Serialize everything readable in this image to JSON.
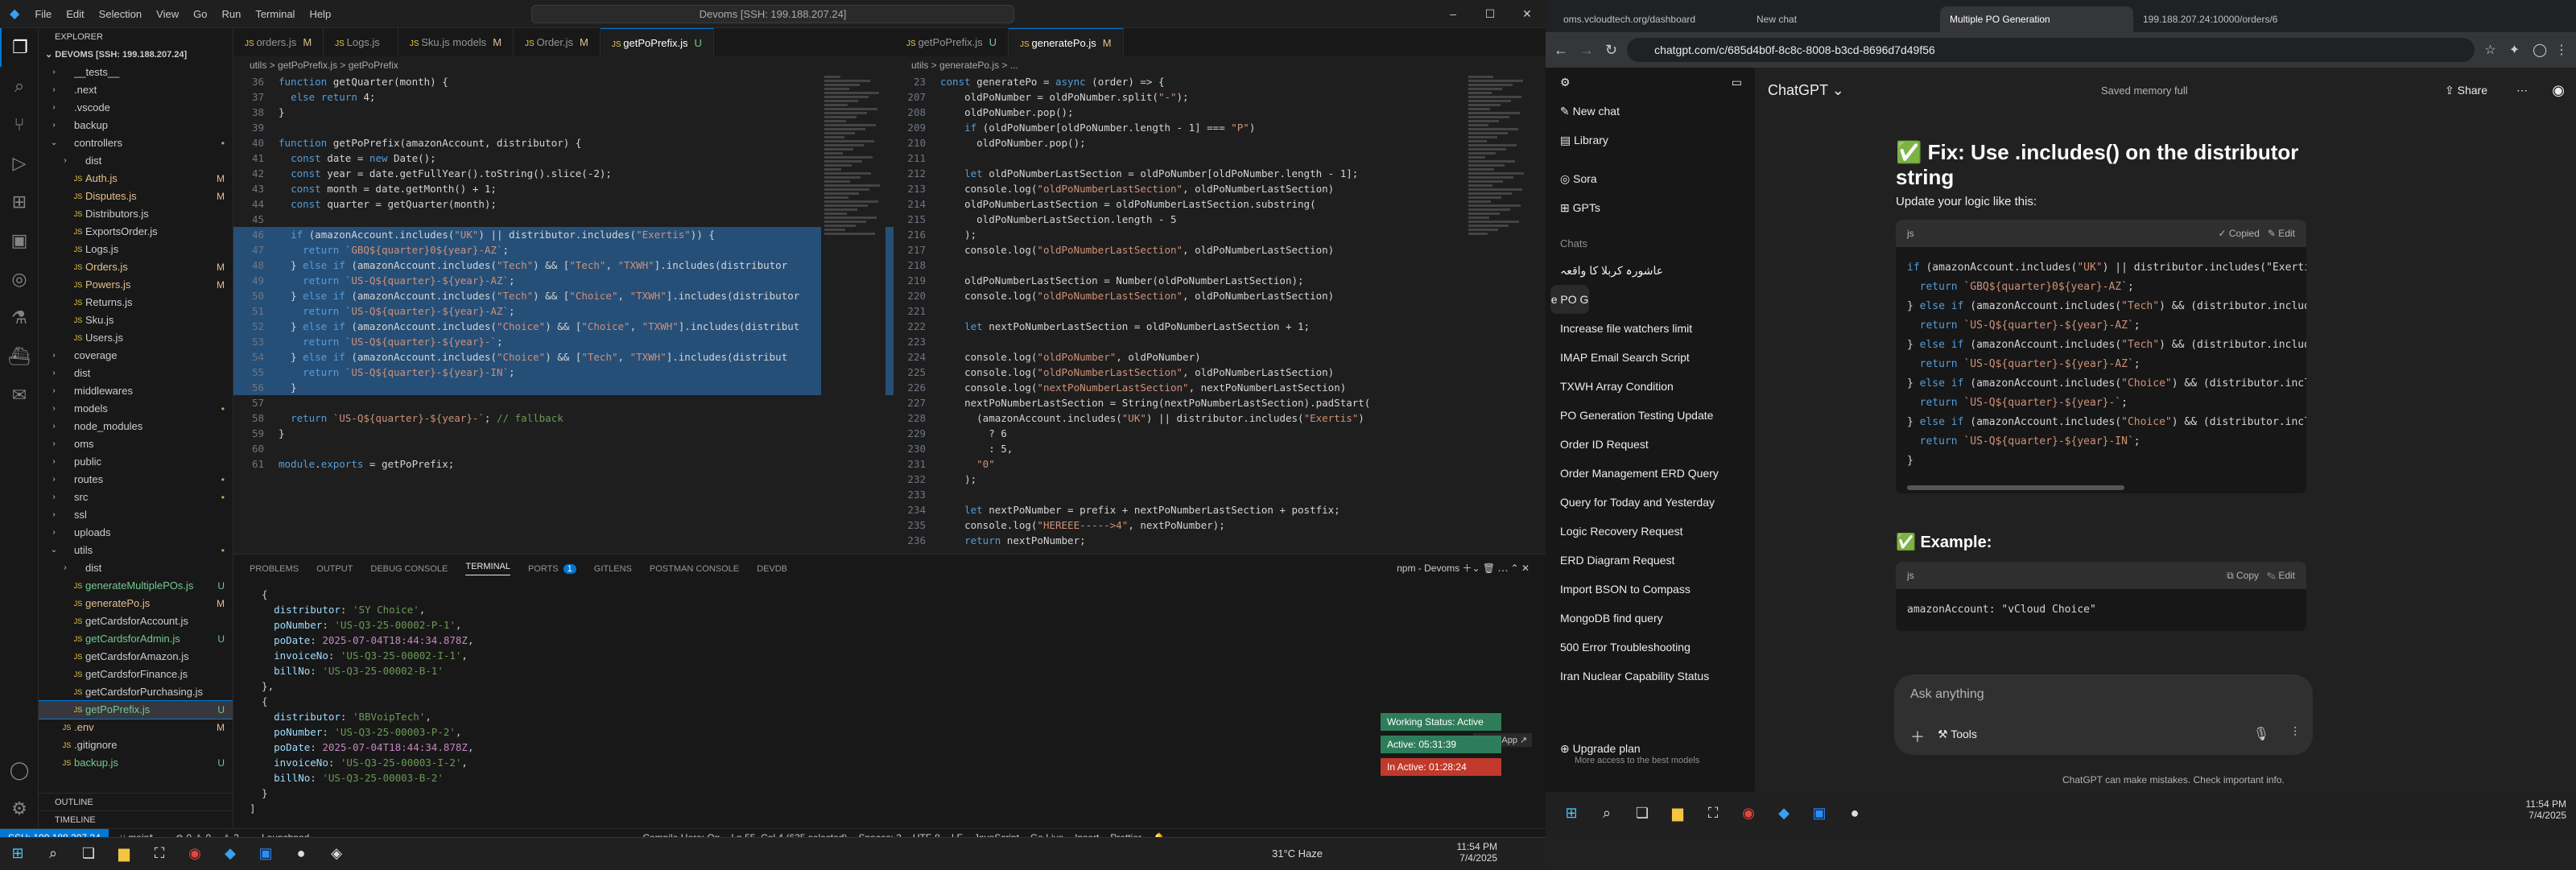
{
  "vscode": {
    "menu": [
      "File",
      "Edit",
      "Selection",
      "View",
      "Go",
      "Run",
      "Terminal",
      "Help"
    ],
    "command_center": "Devoms [SSH: 199.188.207.24]",
    "explorer_title": "EXPLORER",
    "workspace": "DEVOMS [SSH: 199.188.207.24]",
    "tree": [
      {
        "d": 0,
        "t": "f",
        "n": "__tests__",
        "s": ""
      },
      {
        "d": 0,
        "t": "f",
        "n": ".next",
        "s": ""
      },
      {
        "d": 0,
        "t": "f",
        "n": ".vscode",
        "s": ""
      },
      {
        "d": 0,
        "t": "f",
        "n": "backup",
        "s": ""
      },
      {
        "d": 0,
        "t": "fo",
        "n": "controllers",
        "s": "•"
      },
      {
        "d": 1,
        "t": "f",
        "n": "dist",
        "s": ""
      },
      {
        "d": 1,
        "t": "js",
        "n": "Auth.js",
        "s": "M"
      },
      {
        "d": 1,
        "t": "js",
        "n": "Disputes.js",
        "s": "M"
      },
      {
        "d": 1,
        "t": "js",
        "n": "Distributors.js",
        "s": ""
      },
      {
        "d": 1,
        "t": "js",
        "n": "ExportsOrder.js",
        "s": ""
      },
      {
        "d": 1,
        "t": "js",
        "n": "Logs.js",
        "s": ""
      },
      {
        "d": 1,
        "t": "js",
        "n": "Orders.js",
        "s": "M"
      },
      {
        "d": 1,
        "t": "js",
        "n": "Powers.js",
        "s": "M"
      },
      {
        "d": 1,
        "t": "js",
        "n": "Returns.js",
        "s": ""
      },
      {
        "d": 1,
        "t": "js",
        "n": "Sku.js",
        "s": ""
      },
      {
        "d": 1,
        "t": "js",
        "n": "Users.js",
        "s": ""
      },
      {
        "d": 0,
        "t": "f",
        "n": "coverage",
        "s": ""
      },
      {
        "d": 0,
        "t": "f",
        "n": "dist",
        "s": ""
      },
      {
        "d": 0,
        "t": "f",
        "n": "middlewares",
        "s": ""
      },
      {
        "d": 0,
        "t": "f",
        "n": "models",
        "s": "•"
      },
      {
        "d": 0,
        "t": "f",
        "n": "node_modules",
        "s": ""
      },
      {
        "d": 0,
        "t": "f",
        "n": "oms",
        "s": ""
      },
      {
        "d": 0,
        "t": "f",
        "n": "public",
        "s": ""
      },
      {
        "d": 0,
        "t": "f",
        "n": "routes",
        "s": "•"
      },
      {
        "d": 0,
        "t": "f",
        "n": "src",
        "s": "•"
      },
      {
        "d": 0,
        "t": "f",
        "n": "ssl",
        "s": ""
      },
      {
        "d": 0,
        "t": "f",
        "n": "uploads",
        "s": ""
      },
      {
        "d": 0,
        "t": "fo",
        "n": "utils",
        "s": "•"
      },
      {
        "d": 1,
        "t": "f",
        "n": "dist",
        "s": ""
      },
      {
        "d": 1,
        "t": "js",
        "n": "generateMultiplePOs.js",
        "s": "U"
      },
      {
        "d": 1,
        "t": "js",
        "n": "generatePo.js",
        "s": "M"
      },
      {
        "d": 1,
        "t": "js",
        "n": "getCardsforAccount.js",
        "s": ""
      },
      {
        "d": 1,
        "t": "js",
        "n": "getCardsforAdmin.js",
        "s": "U"
      },
      {
        "d": 1,
        "t": "js",
        "n": "getCardsforAmazon.js",
        "s": ""
      },
      {
        "d": 1,
        "t": "js",
        "n": "getCardsforFinance.js",
        "s": ""
      },
      {
        "d": 1,
        "t": "js",
        "n": "getCardsforPurchasing.js",
        "s": ""
      },
      {
        "d": 1,
        "t": "js",
        "n": "getPoPrefix.js",
        "s": "U",
        "sel": true
      },
      {
        "d": 0,
        "t": "js",
        "n": ".env",
        "s": "M"
      },
      {
        "d": 0,
        "t": "js",
        "n": ".gitignore",
        "s": ""
      },
      {
        "d": 0,
        "t": "js",
        "n": "backup.js",
        "s": "U"
      }
    ],
    "outline": "OUTLINE",
    "timeline": "TIMELINE",
    "tabs_left": [
      {
        "n": "orders.js",
        "m": "M",
        "on": false
      },
      {
        "n": "Logs.js",
        "m": "",
        "on": false
      },
      {
        "n": "Sku.js models",
        "m": "M",
        "on": false
      },
      {
        "n": "Order.js",
        "m": "M",
        "on": false
      },
      {
        "n": "getPoPrefix.js",
        "m": "U",
        "on": true
      }
    ],
    "tabs_right": [
      {
        "n": "getPoPrefix.js",
        "m": "U",
        "on": false
      },
      {
        "n": "generatePo.js",
        "m": "M",
        "on": true
      }
    ],
    "breadcrumb_left": "utils > getPoPrefix.js > getPoPrefix",
    "breadcrumb_right": "utils > generatePo.js > ...",
    "code_left": [
      {
        "n": "36",
        "c": "function getQuarter(month) {"
      },
      {
        "n": "37",
        "c": "  else return 4;"
      },
      {
        "n": "38",
        "c": "}"
      },
      {
        "n": "39",
        "c": ""
      },
      {
        "n": "40",
        "c": "function getPoPrefix(amazonAccount, distributor) {"
      },
      {
        "n": "41",
        "c": "  const date = new Date();"
      },
      {
        "n": "42",
        "c": "  const year = date.getFullYear().toString().slice(-2);"
      },
      {
        "n": "43",
        "c": "  const month = date.getMonth() + 1;"
      },
      {
        "n": "44",
        "c": "  const quarter = getQuarter(month);"
      },
      {
        "n": "45",
        "c": ""
      },
      {
        "n": "46",
        "c": "  if (amazonAccount.includes(\"UK\") || distributor.includes(\"Exertis\")) {",
        "hl": true
      },
      {
        "n": "47",
        "c": "    return `GBQ${quarter}0${year}-AZ`;",
        "hl": true
      },
      {
        "n": "48",
        "c": "  } else if (amazonAccount.includes(\"Tech\") && [\"Tech\", \"TXWH\"].includes(distributor",
        "hl": true
      },
      {
        "n": "49",
        "c": "    return `US-Q${quarter}-${year}-AZ`;",
        "hl": true
      },
      {
        "n": "50",
        "c": "  } else if (amazonAccount.includes(\"Tech\") && [\"Choice\", \"TXWH\"].includes(distributor",
        "hl": true
      },
      {
        "n": "51",
        "c": "    return `US-Q${quarter}-${year}-AZ`;",
        "hl": true
      },
      {
        "n": "52",
        "c": "  } else if (amazonAccount.includes(\"Choice\") && [\"Choice\", \"TXWH\"].includes(distribut",
        "hl": true
      },
      {
        "n": "53",
        "c": "    return `US-Q${quarter}-${year}-`;",
        "hl": true
      },
      {
        "n": "54",
        "c": "  } else if (amazonAccount.includes(\"Choice\") && [\"Tech\", \"TXWH\"].includes(distribut",
        "hl": true
      },
      {
        "n": "55",
        "c": "    return `US-Q${quarter}-${year}-IN`;",
        "hl": true
      },
      {
        "n": "56",
        "c": "  }",
        "hl": true
      },
      {
        "n": "57",
        "c": ""
      },
      {
        "n": "58",
        "c": "  return `US-Q${quarter}-${year}-`; // fallback"
      },
      {
        "n": "59",
        "c": "}"
      },
      {
        "n": "60",
        "c": ""
      },
      {
        "n": "61",
        "c": "module.exports = getPoPrefix;"
      }
    ],
    "code_right": [
      {
        "n": "23",
        "c": "const generatePo = async (order) => {"
      },
      {
        "n": "207",
        "c": "    oldPoNumber = oldPoNumber.split(\"-\");"
      },
      {
        "n": "208",
        "c": "    oldPoNumber.pop();"
      },
      {
        "n": "209",
        "c": "    if (oldPoNumber[oldPoNumber.length - 1] === \"P\")"
      },
      {
        "n": "210",
        "c": "      oldPoNumber.pop();"
      },
      {
        "n": "211",
        "c": ""
      },
      {
        "n": "212",
        "c": "    let oldPoNumberLastSection = oldPoNumber[oldPoNumber.length - 1];"
      },
      {
        "n": "213",
        "c": "    console.log(\"oldPoNumberLastSection\", oldPoNumberLastSection)"
      },
      {
        "n": "214",
        "c": "    oldPoNumberLastSection = oldPoNumberLastSection.substring("
      },
      {
        "n": "215",
        "c": "      oldPoNumberLastSection.length - 5"
      },
      {
        "n": "216",
        "c": "    );"
      },
      {
        "n": "217",
        "c": "    console.log(\"oldPoNumberLastSection\", oldPoNumberLastSection)"
      },
      {
        "n": "218",
        "c": ""
      },
      {
        "n": "219",
        "c": "    oldPoNumberLastSection = Number(oldPoNumberLastSection);"
      },
      {
        "n": "220",
        "c": "    console.log(\"oldPoNumberLastSection\", oldPoNumberLastSection)"
      },
      {
        "n": "221",
        "c": ""
      },
      {
        "n": "222",
        "c": "    let nextPoNumberLastSection = oldPoNumberLastSection + 1;"
      },
      {
        "n": "223",
        "c": ""
      },
      {
        "n": "224",
        "c": "    console.log(\"oldPoNumber\", oldPoNumber)"
      },
      {
        "n": "225",
        "c": "    console.log(\"oldPoNumberLastSection\", oldPoNumberLastSection)"
      },
      {
        "n": "226",
        "c": "    console.log(\"nextPoNumberLastSection\", nextPoNumberLastSection)"
      },
      {
        "n": "227",
        "c": "    nextPoNumberLastSection = String(nextPoNumberLastSection).padStart("
      },
      {
        "n": "228",
        "c": "      (amazonAccount.includes(\"UK\") || distributor.includes(\"Exertis\")"
      },
      {
        "n": "229",
        "c": "        ? 6"
      },
      {
        "n": "230",
        "c": "        : 5,"
      },
      {
        "n": "231",
        "c": "      \"0\""
      },
      {
        "n": "232",
        "c": "    );"
      },
      {
        "n": "233",
        "c": ""
      },
      {
        "n": "234",
        "c": "    let nextPoNumber = prefix + nextPoNumberLastSection + postfix;"
      },
      {
        "n": "235",
        "c": "    console.log(\"HEREEE----->4\", nextPoNumber);"
      },
      {
        "n": "236",
        "c": "    return nextPoNumber;"
      }
    ],
    "panel_tabs": [
      "PROBLEMS",
      "OUTPUT",
      "DEBUG CONSOLE",
      "TERMINAL",
      "PORTS",
      "GITLENS",
      "POSTMAN CONSOLE",
      "DEVDB"
    ],
    "panel_active": "TERMINAL",
    "ports_badge": "1",
    "terminal_name": "npm - Devoms",
    "terminal_lines": [
      "  {",
      "    distributor: 'SY Choice',",
      "    poNumber: 'US-Q3-25-00002-P-1',",
      "    poDate: 2025-07-04T18:44:34.878Z,",
      "    invoiceNo: 'US-Q3-25-00002-I-1',",
      "    billNo: 'US-Q3-25-00002-B-1'",
      "  },",
      "  {",
      "    distributor: 'BBVoipTech',",
      "    poNumber: 'US-Q3-25-00003-P-2',",
      "    poDate: 2025-07-04T18:44:34.878Z,",
      "    invoiceNo: 'US-Q3-25-00003-I-2',",
      "    billNo: 'US-Q3-25-00003-B-2'",
      "  }",
      "]"
    ],
    "open_app": "Open App ↗",
    "notices": [
      {
        "t": "Working Status: Active",
        "c": "#2e7d5a"
      },
      {
        "t": "Active: 05:31:39",
        "c": "#2e7d5a"
      },
      {
        "t": "In Active: 01:28:24",
        "c": "#c0392b"
      }
    ],
    "status": {
      "remote": "SSH: 199.188.207.24",
      "branch": "main*",
      "errors": "⊗ 0 ⚠ 0",
      "warn": "3",
      "launch": "Launchpad",
      "compile": "Compile Hero: On",
      "cursor": "Ln 55, Col 4 (635 selected)",
      "spaces": "Spaces: 2",
      "enc": "UTF-8",
      "eol": "LF",
      "lang": "JavaScript",
      "golive": "Go Live",
      "insert": "Insert",
      "prettier": "Prettier"
    },
    "taskbar_weather": "31°C Haze",
    "taskbar_time": "11:54 PM",
    "taskbar_date": "7/4/2025"
  },
  "chrome": {
    "tabs": [
      {
        "t": "oms.vcloudtech.org/dashboard",
        "on": false
      },
      {
        "t": "New chat",
        "on": false
      },
      {
        "t": "Multiple PO Generation",
        "on": true
      },
      {
        "t": "199.188.207.24:10000/orders/6",
        "on": false
      }
    ],
    "url": "chatgpt.com/c/685d4b0f-8c8c-8008-b3cd-8696d7d49f56",
    "sidebar": {
      "new_chat": "New chat",
      "library": "Library",
      "sora": "Sora",
      "gpts": "GPTs",
      "chats_header": "Chats",
      "chats": [
        "عاشورہ کربلا کا واقعہ",
        "Multiple PO Generation",
        "Increase file watchers limit",
        "IMAP Email Search Script",
        "TXWH Array Condition",
        "PO Generation Testing Update",
        "Order ID Request",
        "Order Management ERD Query",
        "Query for Today and Yesterday",
        "Logic Recovery Request",
        "ERD Diagram Request",
        "Import BSON to Compass",
        "MongoDB find query",
        "500 Error Troubleshooting",
        "Iran Nuclear Capability Status"
      ],
      "upgrade": "Upgrade plan",
      "upgrade_sub": "More access to the best models"
    },
    "main": {
      "model": "ChatGPT ⌄",
      "memory": "Saved memory full",
      "share": "Share",
      "fix_heading": "✅ Fix: Use .includes() on the distributor string",
      "update_text": "Update your logic like this:",
      "code_lang": "js",
      "copied": "✓ Copied",
      "edit": "✎ Edit",
      "code": [
        "if (amazonAccount.includes(\"UK\") || distributor.includes(\"Exerti",
        "  return `GBQ${quarter}0${year}-AZ`;",
        "} else if (amazonAccount.includes(\"Tech\") && (distributor.includ",
        "  return `US-Q${quarter}-${year}-AZ`;",
        "} else if (amazonAccount.includes(\"Tech\") && (distributor.includ",
        "  return `US-Q${quarter}-${year}-AZ`;",
        "} else if (amazonAccount.includes(\"Choice\") && (distributor.incl",
        "  return `US-Q${quarter}-${year}-`;",
        "} else if (amazonAccount.includes(\"Choice\") && (distributor.incl",
        "  return `US-Q${quarter}-${year}-IN`;",
        "}"
      ],
      "example_heading": "✅ Example:",
      "copy": "⧉ Copy",
      "example_code": "amazonAccount: \"vCloud Choice\"",
      "ask": "Ask anything",
      "tools": "Tools",
      "disclaimer": "ChatGPT can make mistakes. Check important info."
    },
    "tray_time": "11:54 PM",
    "tray_date": "7/4/2025"
  }
}
